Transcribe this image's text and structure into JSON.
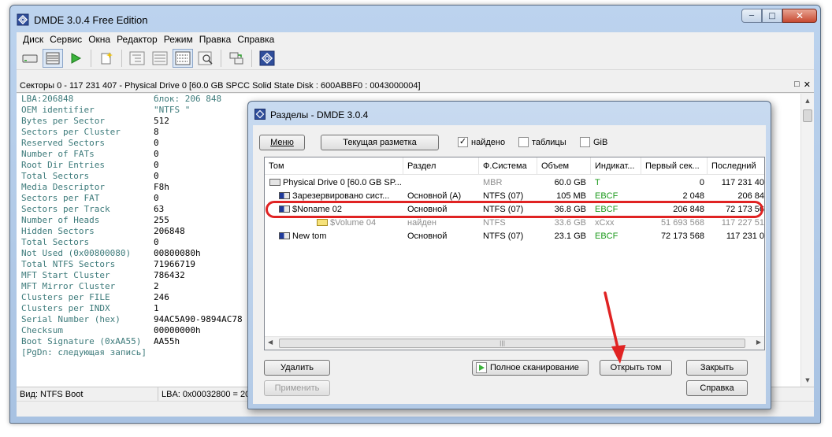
{
  "main": {
    "title": "DMDE 3.0.4 Free Edition",
    "menu": [
      "Диск",
      "Сервис",
      "Окна",
      "Редактор",
      "Режим",
      "Правка",
      "Справка"
    ],
    "sector_bar": "Секторы 0 - 117 231 407 - Physical Drive 0 [60.0 GB SPCC Solid State Disk : 600ABBF0 : 0043000004]",
    "fields": [
      {
        "name": "LBA:206848",
        "value": "блок: 206 848",
        "teal": true
      },
      {
        "name": "OEM identifier",
        "value": "\"NTFS    \"",
        "teal": true
      },
      {
        "name": "Bytes per Sector",
        "value": "512"
      },
      {
        "name": "Sectors per Cluster",
        "value": "8"
      },
      {
        "name": "Reserved Sectors",
        "value": "0"
      },
      {
        "name": "Number of FATs",
        "value": "0"
      },
      {
        "name": "Root Dir Entries",
        "value": "0"
      },
      {
        "name": "Total Sectors",
        "value": "0"
      },
      {
        "name": "Media Descriptor",
        "value": "F8h"
      },
      {
        "name": "Sectors per FAT",
        "value": "0"
      },
      {
        "name": "Sectors per Track",
        "value": "63"
      },
      {
        "name": "Number of Heads",
        "value": "255"
      },
      {
        "name": "Hidden Sectors",
        "value": "206848"
      },
      {
        "name": "Total Sectors",
        "value": "0"
      },
      {
        "name": "Not Used (0x00800080)",
        "value": "00800080h"
      },
      {
        "name": "Total NTFS Sectors",
        "value": "71966719"
      },
      {
        "name": "MFT Start Cluster",
        "value": "786432"
      },
      {
        "name": "MFT Mirror Cluster",
        "value": "2"
      },
      {
        "name": "Clusters per FILE",
        "value": "246"
      },
      {
        "name": "Clusters per INDX",
        "value": "1"
      },
      {
        "name": "Serial Number (hex)",
        "value": "94AC5A90-9894AC78"
      },
      {
        "name": "Checksum",
        "value": "00000000h"
      },
      {
        "name": "Boot Signature (0xAA55)",
        "value": "AA55h"
      },
      {
        "name": "[PgDn: следующая запись]",
        "value": ""
      }
    ],
    "status": {
      "view": "Вид:   NTFS Boot",
      "lba": "LBA: 0x00032800 = 20"
    }
  },
  "dialog": {
    "title": "Разделы - DMDE 3.0.4",
    "menu_button": "Меню",
    "layout_button": "Текущая разметка",
    "checks": [
      {
        "label": "найдено",
        "checked": true
      },
      {
        "label": "таблицы",
        "checked": false
      },
      {
        "label": "GiB",
        "checked": false
      }
    ],
    "columns": [
      "Том",
      "Раздел",
      "Ф.Система",
      "Объем",
      "Индикат...",
      "Первый сек...",
      "Последний"
    ],
    "rows": [
      {
        "name": "Physical Drive 0 [60.0 GB SP...",
        "part": "",
        "fs": "MBR",
        "size": "60.0 GB",
        "ind": "T",
        "first": "0",
        "last": "117 231 40",
        "level": 0,
        "grey": false
      },
      {
        "name": "Зарезервировано сист...",
        "part": "Основной (A)",
        "fs": "NTFS (07)",
        "size": "105 MB",
        "ind": "EBCF",
        "first": "2 048",
        "last": "206 84",
        "level": 1,
        "grey": false
      },
      {
        "name": "$Noname 02",
        "part": "Основной",
        "fs": "NTFS (07)",
        "size": "36.8 GB",
        "ind": "EBCF",
        "first": "206 848",
        "last": "72 173 56",
        "level": 1,
        "grey": false
      },
      {
        "name": "$Volume 04",
        "part": "найден",
        "fs": "NTFS",
        "size": "33.6 GB",
        "ind": "xCxx",
        "first": "51 693 568",
        "last": "117 227 51",
        "level": 2,
        "grey": true
      },
      {
        "name": "New tom",
        "part": "Основной",
        "fs": "NTFS (07)",
        "size": "23.1 GB",
        "ind": "EBCF",
        "first": "72 173 568",
        "last": "117 231 0",
        "level": 1,
        "grey": false
      }
    ],
    "buttons": {
      "delete": "Удалить",
      "apply": "Применить",
      "full_scan": "Полное сканирование",
      "open_volume": "Открыть том",
      "close": "Закрыть",
      "help": "Справка"
    }
  }
}
